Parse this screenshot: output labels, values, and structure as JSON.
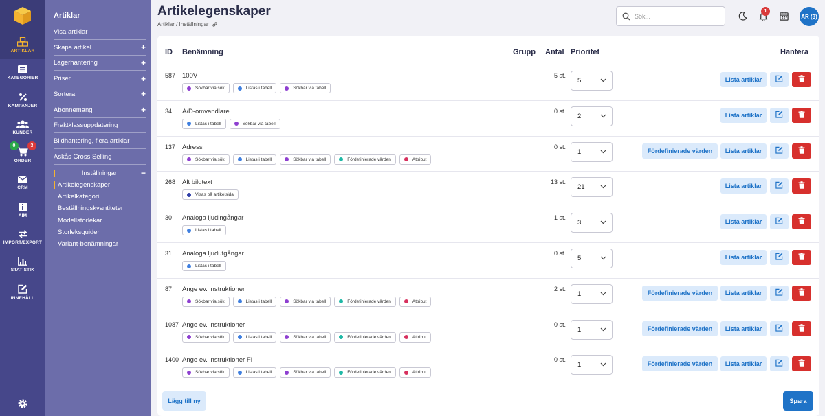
{
  "rail": {
    "items": [
      {
        "label": "ARTIKLAR",
        "icon": "cubes-icon"
      },
      {
        "label": "KATEGORIER",
        "icon": "list-icon"
      },
      {
        "label": "KAMPANJER",
        "icon": "percent-icon"
      },
      {
        "label": "KUNDER",
        "icon": "users-icon"
      },
      {
        "label": "ORDER",
        "icon": "cart-icon"
      },
      {
        "label": "CRM",
        "icon": "envelope-icon"
      },
      {
        "label": "AIM",
        "icon": "info-icon"
      },
      {
        "label": "IMPORT/EXPORT",
        "icon": "exchange-icon"
      },
      {
        "label": "STATISTIK",
        "icon": "bar-chart-icon"
      },
      {
        "label": "INNEHÅLL",
        "icon": "edit-icon"
      }
    ],
    "order_badge_green": "0",
    "order_badge_red": "3",
    "settings_icon": "gear-icon"
  },
  "submenu": {
    "title": "Artiklar",
    "items": [
      {
        "label": "Visa artiklar",
        "plus": ""
      },
      {
        "label": "Skapa artikel",
        "plus": "+"
      },
      {
        "label": "Lagerhantering",
        "plus": "+"
      },
      {
        "label": "Priser",
        "plus": "+"
      },
      {
        "label": "Sortera",
        "plus": "+"
      },
      {
        "label": "Abonnemang",
        "plus": "+"
      },
      {
        "label": "Fraktklassuppdatering",
        "plus": ""
      },
      {
        "label": "Bildhantering, flera artiklar",
        "plus": ""
      },
      {
        "label": "Askås Cross Selling",
        "plus": ""
      }
    ],
    "settings_label": "Inställningar",
    "settings_toggle": "−",
    "sub_items": [
      "Artikelegenskaper",
      "Artikelkategori",
      "Beställningskvantiteter",
      "Modellstorlekar",
      "Storleksguider",
      "Variant-benämningar"
    ]
  },
  "header": {
    "title": "Artikelegenskaper",
    "breadcrumb": "Artiklar / Inställningar",
    "search_placeholder": "Sök...",
    "notification_count": "1",
    "avatar": "AR (3)"
  },
  "table": {
    "headers": {
      "id": "ID",
      "name": "Benämning",
      "group": "Grupp",
      "qty": "Antal",
      "priority": "Prioritet",
      "manage": "Hantera"
    },
    "tag_colors": {
      "Sökbar via sök": "#8e3fd1",
      "Listas i tabell": "#3f7fe0",
      "Sökbar via tabell": "#8e3fd1",
      "Fördefinierade värden": "#1fb8a6",
      "Attribut": "#d7305e",
      "Visas på artikelsida": "#2f3fa8"
    },
    "rows": [
      {
        "id": "587",
        "name": "100V",
        "qty": "5 st.",
        "priority": "5",
        "predef": false,
        "tags": [
          "Sökbar via sök",
          "Listas i tabell",
          "Sökbar via tabell"
        ]
      },
      {
        "id": "34",
        "name": "A/D-omvandlare",
        "qty": "0 st.",
        "priority": "2",
        "predef": false,
        "tags": [
          "Listas i tabell",
          "Sökbar via tabell"
        ]
      },
      {
        "id": "137",
        "name": "Adress",
        "qty": "0 st.",
        "priority": "1",
        "predef": true,
        "tags": [
          "Sökbar via sök",
          "Listas i tabell",
          "Sökbar via tabell",
          "Fördefinierade värden",
          "Attribut"
        ]
      },
      {
        "id": "268",
        "name": "Alt bildtext",
        "qty": "13 st.",
        "priority": "21",
        "predef": false,
        "tags": [
          "Visas på artikelsida"
        ]
      },
      {
        "id": "30",
        "name": "Analoga ljudingångar",
        "qty": "1 st.",
        "priority": "3",
        "predef": false,
        "tags": [
          "Listas i tabell"
        ]
      },
      {
        "id": "31",
        "name": "Analoga ljudutgångar",
        "qty": "0 st.",
        "priority": "5",
        "predef": false,
        "tags": [
          "Listas i tabell"
        ]
      },
      {
        "id": "87",
        "name": "Ange ev. instruktioner",
        "qty": "2 st.",
        "priority": "1",
        "predef": true,
        "tags": [
          "Sökbar via sök",
          "Listas i tabell",
          "Sökbar via tabell",
          "Fördefinierade värden",
          "Attribut"
        ]
      },
      {
        "id": "1087",
        "name": "Ange ev. instruktioner",
        "qty": "0 st.",
        "priority": "1",
        "predef": true,
        "tags": [
          "Sökbar via sök",
          "Listas i tabell",
          "Sökbar via tabell",
          "Fördefinierade värden",
          "Attribut"
        ]
      },
      {
        "id": "1400",
        "name": "Ange ev. instruktioner FI",
        "qty": "0 st.",
        "priority": "1",
        "predef": true,
        "tags": [
          "Sökbar via sök",
          "Listas i tabell",
          "Sökbar via tabell",
          "Fördefinierade värden",
          "Attribut"
        ]
      }
    ],
    "predef_label": "Fördefinierade värden",
    "list_label": "Lista artiklar"
  },
  "footer": {
    "add_label": "Lägg till ny",
    "save_label": "Spara"
  },
  "colors": {
    "rail": "#46478a",
    "submenu": "#6c6daa",
    "accent": "#f4b331",
    "primary": "#1f73c7",
    "danger": "#d7302d"
  }
}
